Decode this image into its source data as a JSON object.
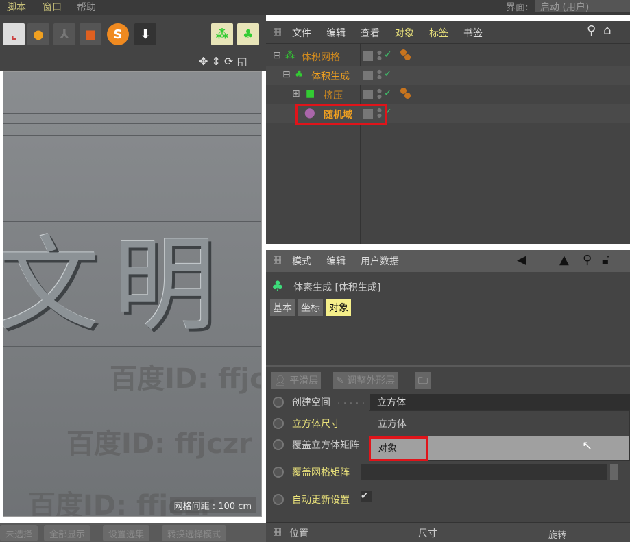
{
  "menubar": {
    "items": [
      "脚本",
      "窗口",
      "帮助"
    ],
    "layout_label": "界面:",
    "layout_value": "启动 (用户)"
  },
  "toolbar": {
    "icons": [
      "coordinate-system-icon",
      "axis-icon",
      "joint-icon",
      "bake-icon",
      "sketch-icon",
      "drop-icon",
      "volume-mesher-icon",
      "volume-builder-icon"
    ]
  },
  "viewport": {
    "overlay_text": "文明",
    "grid_spacing": "网格间距 : 100 cm",
    "watermarks": [
      "百度ID: ffjczr",
      "百度ID: ffjczr",
      "百度ID: ffjczr"
    ]
  },
  "bottom_buttons": [
    "未选择",
    "全部显示",
    "设置选集",
    "转换选择模式"
  ],
  "object_manager": {
    "menu": [
      "文件",
      "编辑",
      "查看",
      "对象",
      "标签",
      "书签"
    ],
    "objects": [
      {
        "name": "体积网格",
        "has_tag": true
      },
      {
        "name": "体积生成",
        "has_tag": false
      },
      {
        "name": "挤压",
        "has_tag": true
      },
      {
        "name": "随机域",
        "has_tag": false
      }
    ]
  },
  "attributes": {
    "menu": [
      "模式",
      "编辑",
      "用户数据"
    ],
    "title": "体素生成 [体积生成]",
    "tabs": [
      "基本",
      "坐标",
      "对象"
    ],
    "active_tab": "对象",
    "layer_buttons": [
      "平滑层",
      "调整外形层"
    ],
    "fields": [
      {
        "label": "创建空间",
        "value": "立方体"
      },
      {
        "label": "立方体尺寸"
      },
      {
        "label": "覆盖立方体矩阵"
      },
      {
        "label": "覆盖网格矩阵"
      },
      {
        "label": "自动更新设置"
      }
    ],
    "dropdown_options": [
      "立方体",
      "对象"
    ],
    "highlighted_option": "对象"
  },
  "coordinates": {
    "headers": [
      "位置",
      "尺寸",
      "旋转"
    ]
  },
  "colors": {
    "accent": "#d28b1e",
    "highlight_box": "#e0141a",
    "active_tab": "#f5ef8a"
  }
}
